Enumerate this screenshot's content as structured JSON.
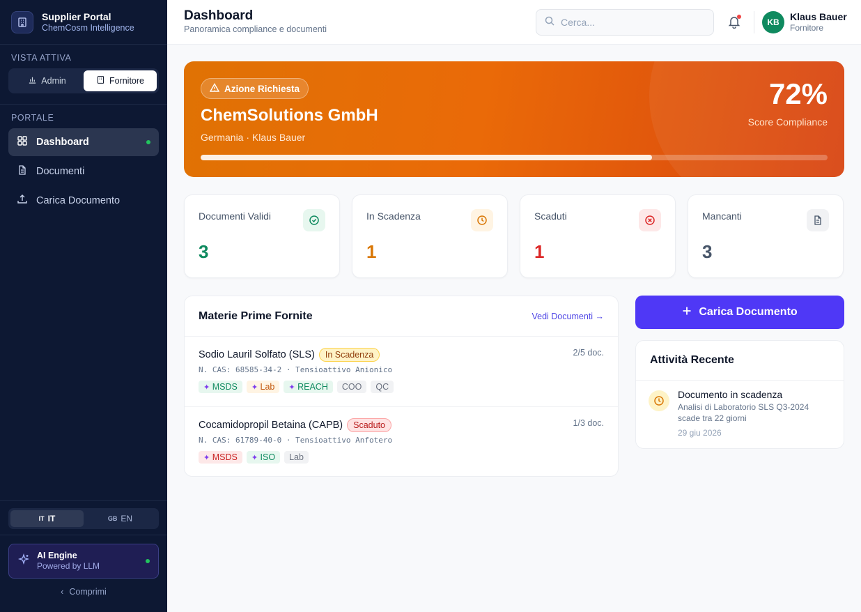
{
  "brand": {
    "title": "Supplier Portal",
    "subtitle": "ChemCosm Intelligence"
  },
  "vista": {
    "label": "VISTA ATTIVA",
    "options": [
      {
        "label": "Admin",
        "icon": "bar-chart-icon",
        "active": false
      },
      {
        "label": "Fornitore",
        "icon": "building-icon",
        "active": true
      }
    ]
  },
  "portale": {
    "label": "PORTALE",
    "items": [
      {
        "label": "Dashboard",
        "icon": "grid-icon",
        "active": true
      },
      {
        "label": "Documenti",
        "icon": "document-icon",
        "active": false
      },
      {
        "label": "Carica Documento",
        "icon": "upload-icon",
        "active": false
      }
    ]
  },
  "language": {
    "options": [
      {
        "flag": "IT",
        "label": "IT",
        "active": true
      },
      {
        "flag": "GB",
        "label": "EN",
        "active": false
      }
    ]
  },
  "ai_engine": {
    "title": "AI Engine",
    "subtitle": "Powered by LLM"
  },
  "collapse_label": "Comprimi",
  "header": {
    "title": "Dashboard",
    "subtitle": "Panoramica compliance e documenti",
    "search_placeholder": "Cerca...",
    "user": {
      "initials": "KB",
      "name": "Klaus Bauer",
      "role": "Fornitore"
    }
  },
  "hero": {
    "badge": "Azione Richiesta",
    "company": "ChemSolutions GmbH",
    "meta": "Germania · Klaus Bauer",
    "score": "72%",
    "score_label": "Score Compliance",
    "progress_fraction": 0.72,
    "colors": {
      "start": "#e07204",
      "end": "#d84410"
    }
  },
  "stats": [
    {
      "label": "Documenti Validi",
      "value": "3",
      "icon": "check-circle-icon",
      "color": "#0f8a5f",
      "bg": "#e7f7ef"
    },
    {
      "label": "In Scadenza",
      "value": "1",
      "icon": "clock-icon",
      "color": "#d97706",
      "bg": "#fff4e3"
    },
    {
      "label": "Scaduti",
      "value": "1",
      "icon": "x-circle-icon",
      "color": "#dc2626",
      "bg": "#fde8e8"
    },
    {
      "label": "Mancanti",
      "value": "3",
      "icon": "file-icon",
      "color": "#475569",
      "bg": "#f1f2f4"
    }
  ],
  "materials": {
    "title": "Materie Prime Fornite",
    "link": "Vedi Documenti →",
    "rows": [
      {
        "name": "Sodio Lauril Solfato (SLS)",
        "status": "In Scadenza",
        "status_type": "warn",
        "docs": "2/5 doc.",
        "cas": "N. CAS: 68585-34-2 · Tensioattivo Anionico",
        "tags": [
          {
            "label": "MSDS",
            "type": "green",
            "star": true
          },
          {
            "label": "Lab",
            "type": "orange",
            "star": true
          },
          {
            "label": "REACH",
            "type": "green",
            "star": true
          },
          {
            "label": "COO",
            "type": "gray",
            "star": false
          },
          {
            "label": "QC",
            "type": "gray",
            "star": false
          }
        ]
      },
      {
        "name": "Cocamidopropil Betaina (CAPB)",
        "status": "Scaduto",
        "status_type": "danger",
        "docs": "1/3 doc.",
        "cas": "N. CAS: 61789-40-0 · Tensioattivo Anfotero",
        "tags": [
          {
            "label": "MSDS",
            "type": "red",
            "star": true
          },
          {
            "label": "ISO",
            "type": "green",
            "star": true
          },
          {
            "label": "Lab",
            "type": "gray",
            "star": false
          }
        ]
      }
    ]
  },
  "cta": {
    "label": "Carica Documento",
    "icon": "plus-icon",
    "color": "#4f38f6"
  },
  "activity": {
    "title": "Attività Recente",
    "items": [
      {
        "title": "Documento in scadenza",
        "desc_1": "Analisi di Laboratorio SLS Q3-2024",
        "desc_2": "scade tra 22 giorni",
        "date": "29 giu 2026",
        "icon": "clock-icon"
      }
    ]
  }
}
